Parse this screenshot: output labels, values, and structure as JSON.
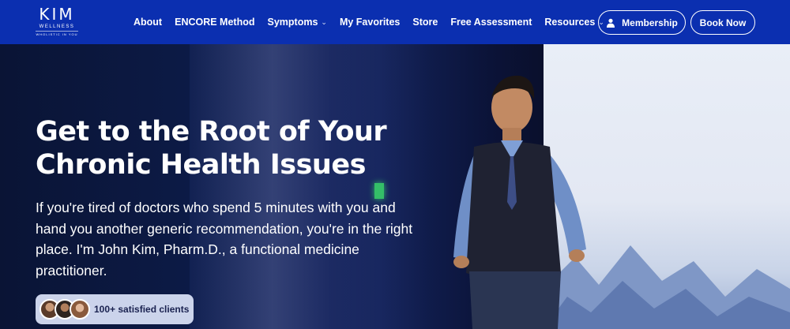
{
  "brand": {
    "name": "KIM",
    "sub": "WELLNESS",
    "tagline": "WHOLISTIC IN YOU"
  },
  "nav": {
    "items": [
      {
        "label": "About",
        "has_dropdown": false
      },
      {
        "label": "ENCORE Method",
        "has_dropdown": false
      },
      {
        "label": "Symptoms",
        "has_dropdown": true
      },
      {
        "label": "My Favorites",
        "has_dropdown": false
      },
      {
        "label": "Store",
        "has_dropdown": false
      },
      {
        "label": "Free Assessment",
        "has_dropdown": false
      },
      {
        "label": "Resources",
        "has_dropdown": true
      }
    ],
    "membership_label": "Membership",
    "book_label": "Book Now"
  },
  "hero": {
    "title_line1": "Get to the Root of Your",
    "title_line2": "Chronic Health Issues",
    "text": "If you're tired of doctors who spend 5 minutes with you and hand you another generic recommendation, you're in the right place. I'm John Kim, Pharm.D., a functional medicine practitioner.",
    "clients_label": "100+ satisfied clients"
  },
  "colors": {
    "nav_bg": "#0b2fb0",
    "hero_bg": "#0d1c4a",
    "text": "#ffffff",
    "badge_bg": "#dce4fa"
  },
  "icons": {
    "person": "person-icon",
    "chevron": "chevron-down-icon"
  }
}
